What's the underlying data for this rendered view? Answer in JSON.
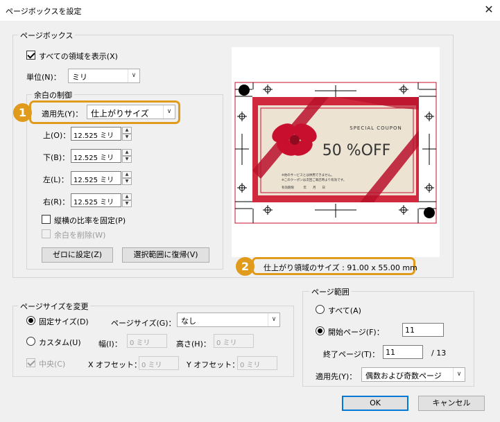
{
  "window": {
    "title": "ページボックスを設定",
    "close_glyph": "✕"
  },
  "page_box": {
    "group_label": "ページボックス",
    "show_all": {
      "label": "すべての領域を表示(X)",
      "checked": true
    },
    "unit_label": "単位(N)：",
    "unit_value": "ミリ"
  },
  "margins": {
    "group_label": "余白の制御",
    "apply_to_label": "適用先(Y)：",
    "apply_to_value": "仕上がりサイズ",
    "top_label": "上(O)：",
    "top_value": "12.525 ミリ",
    "bottom_label": "下(B)：",
    "bottom_value": "12.525 ミリ",
    "left_label": "左(L)：",
    "left_value": "12.525 ミリ",
    "right_label": "右(R)：",
    "right_value": "12.525 ミリ",
    "constrain": {
      "label": "縦横の比率を固定(P)",
      "checked": false
    },
    "remove_white": {
      "label": "余白を削除(W)",
      "checked": false
    },
    "set_zero_button": "ゼロに設定(Z)",
    "revert_button": "選択範囲に復帰(V)"
  },
  "preview": {
    "coupon_title": "SPECIAL  COUPON",
    "coupon_value": "50 %OFF",
    "fine_print_1": "※他のサービスとは併用できません。",
    "fine_print_2": "※このクーポンは次回ご来店時より有効です。",
    "date_row": "有効期限　　　年　　月　　日",
    "trim_size_caption": "仕上がり領域のサイズ : 91.00 x 55.00 mm",
    "accent_color": "#c8102e"
  },
  "page_size": {
    "group_label": "ページサイズを変更",
    "fixed": {
      "label": "固定サイズ(D)",
      "selected": true
    },
    "page_size_label": "ページサイズ(G)：",
    "page_size_value": "なし",
    "custom": {
      "label": "カスタム(U)",
      "selected": false
    },
    "width_label": "幅(I)：",
    "width_value": "0 ミリ",
    "height_label": "高さ(H)：",
    "height_value": "0 ミリ",
    "center": {
      "label": "中央(C)",
      "checked": true
    },
    "xoffset_label": "X オフセット：",
    "xoffset_value": "0 ミリ",
    "yoffset_label": "Y オフセット：",
    "yoffset_value": "0 ミリ"
  },
  "page_range": {
    "group_label": "ページ範囲",
    "all": {
      "label": "すべて(A)",
      "selected": false
    },
    "start_label": "開始ページ(F)：",
    "start_value": "11",
    "end_label": "終了ページ(T)：",
    "end_value": "11",
    "total": "/ 13",
    "apply_label": "適用先(Y)：",
    "apply_value": "偶数および奇数ページ"
  },
  "buttons": {
    "ok": "OK",
    "cancel": "キャンセル"
  },
  "callouts": {
    "one": "1",
    "two": "2",
    "color": "#e09b1c"
  }
}
